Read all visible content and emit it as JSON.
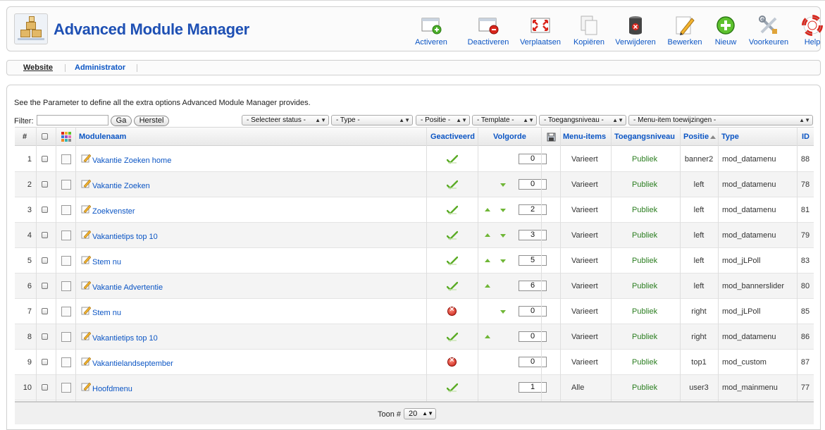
{
  "app": {
    "title": "Advanced Module Manager"
  },
  "toolbar": {
    "buttons": [
      {
        "label": "Activeren",
        "icon": "activate-icon"
      },
      {
        "label": "Deactiveren",
        "icon": "deactivate-icon"
      },
      {
        "label": "Verplaatsen",
        "icon": "move-icon"
      },
      {
        "label": "Kopiëren",
        "icon": "copy-icon"
      },
      {
        "label": "Verwijderen",
        "icon": "trash-icon"
      },
      {
        "label": "Bewerken",
        "icon": "edit-icon"
      },
      {
        "label": "Nieuw",
        "icon": "new-icon"
      },
      {
        "label": "Voorkeuren",
        "icon": "tools-icon"
      },
      {
        "label": "Help",
        "icon": "help-icon"
      }
    ]
  },
  "submenu": {
    "items": [
      "Website",
      "Administrator"
    ],
    "active": "Website"
  },
  "intro": "See the Parameter to define all the extra options Advanced Module Manager provides.",
  "filter": {
    "label": "Filter:",
    "value": "",
    "go_label": "Ga",
    "reset_label": "Herstel",
    "selects": [
      "- Selecteer status -",
      "- Type -",
      "- Positie -",
      "- Template -",
      "- Toegangsniveau -",
      "- Menu-item toewijzingen -"
    ]
  },
  "table": {
    "headers": {
      "num": "#",
      "name": "Modulenaam",
      "enabled": "Geactiveerd",
      "order": "Volgorde",
      "menu": "Menu-items",
      "access": "Toegangsniveau",
      "position": "Positie",
      "type": "Type",
      "id": "ID"
    },
    "rows": [
      {
        "num": "1",
        "name": "Vakantie Zoeken home",
        "enabled": true,
        "up": false,
        "down": false,
        "order": "0",
        "menu": "Varieert",
        "access": "Publiek",
        "position": "banner2",
        "type": "mod_datamenu",
        "id": "88"
      },
      {
        "num": "2",
        "name": "Vakantie Zoeken",
        "enabled": true,
        "up": false,
        "down": true,
        "order": "0",
        "menu": "Varieert",
        "access": "Publiek",
        "position": "left",
        "type": "mod_datamenu",
        "id": "78"
      },
      {
        "num": "3",
        "name": "Zoekvenster",
        "enabled": true,
        "up": true,
        "down": true,
        "order": "2",
        "menu": "Varieert",
        "access": "Publiek",
        "position": "left",
        "type": "mod_datamenu",
        "id": "81"
      },
      {
        "num": "4",
        "name": "Vakantietips top 10",
        "enabled": true,
        "up": true,
        "down": true,
        "order": "3",
        "menu": "Varieert",
        "access": "Publiek",
        "position": "left",
        "type": "mod_datamenu",
        "id": "79"
      },
      {
        "num": "5",
        "name": "Stem nu",
        "enabled": true,
        "up": true,
        "down": true,
        "order": "5",
        "menu": "Varieert",
        "access": "Publiek",
        "position": "left",
        "type": "mod_jLPoll",
        "id": "83"
      },
      {
        "num": "6",
        "name": "Vakantie Advertentie",
        "enabled": true,
        "up": true,
        "down": false,
        "order": "6",
        "menu": "Varieert",
        "access": "Publiek",
        "position": "left",
        "type": "mod_bannerslider",
        "id": "80"
      },
      {
        "num": "7",
        "name": "Stem nu",
        "enabled": false,
        "up": false,
        "down": true,
        "order": "0",
        "menu": "Varieert",
        "access": "Publiek",
        "position": "right",
        "type": "mod_jLPoll",
        "id": "85"
      },
      {
        "num": "8",
        "name": "Vakantietips top 10",
        "enabled": true,
        "up": true,
        "down": false,
        "order": "0",
        "menu": "Varieert",
        "access": "Publiek",
        "position": "right",
        "type": "mod_datamenu",
        "id": "86"
      },
      {
        "num": "9",
        "name": "Vakantielandseptember",
        "enabled": false,
        "up": false,
        "down": false,
        "order": "0",
        "menu": "Varieert",
        "access": "Publiek",
        "position": "top1",
        "type": "mod_custom",
        "id": "87"
      },
      {
        "num": "10",
        "name": "Hoofdmenu",
        "enabled": true,
        "up": false,
        "down": false,
        "order": "1",
        "menu": "Alle",
        "access": "Publiek",
        "position": "user3",
        "type": "mod_mainmenu",
        "id": "77"
      }
    ]
  },
  "pagination": {
    "label": "Toon #",
    "value": "20"
  }
}
